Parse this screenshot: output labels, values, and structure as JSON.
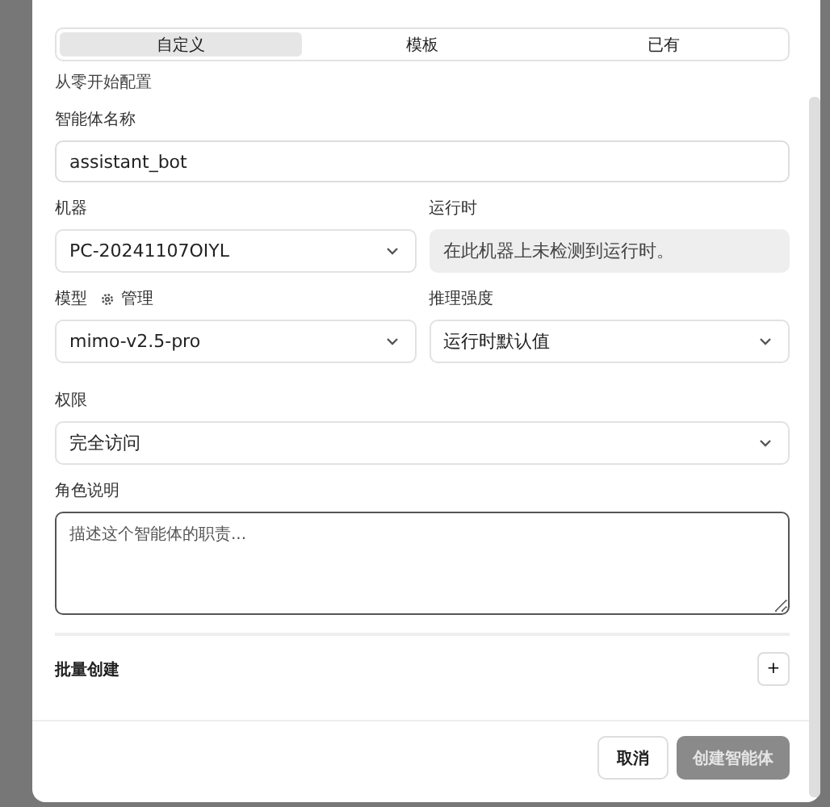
{
  "tabs": [
    {
      "label": "自定义",
      "selected": true
    },
    {
      "label": "模板",
      "selected": false
    },
    {
      "label": "已有",
      "selected": false
    }
  ],
  "subtitle": "从零开始配置",
  "name_field": {
    "label": "智能体名称",
    "value": "assistant_bot"
  },
  "machine": {
    "label": "机器",
    "value": "PC-20241107OIYL"
  },
  "runtime": {
    "label": "运行时",
    "value": "在此机器上未检测到运行时。",
    "disabled": true
  },
  "model": {
    "label": "模型",
    "manage_link": "管理",
    "value": "mimo-v2.5-pro"
  },
  "reasoning": {
    "label": "推理强度",
    "value": "运行时默认值"
  },
  "permission": {
    "label": "权限",
    "value": "完全访问"
  },
  "role": {
    "label": "角色说明",
    "placeholder": "描述这个智能体的职责..."
  },
  "batch": {
    "label": "批量创建",
    "button": "+"
  },
  "buttons": [
    {
      "label": "取消",
      "disabled": false
    },
    {
      "label": "创建智能体",
      "disabled": true
    }
  ]
}
